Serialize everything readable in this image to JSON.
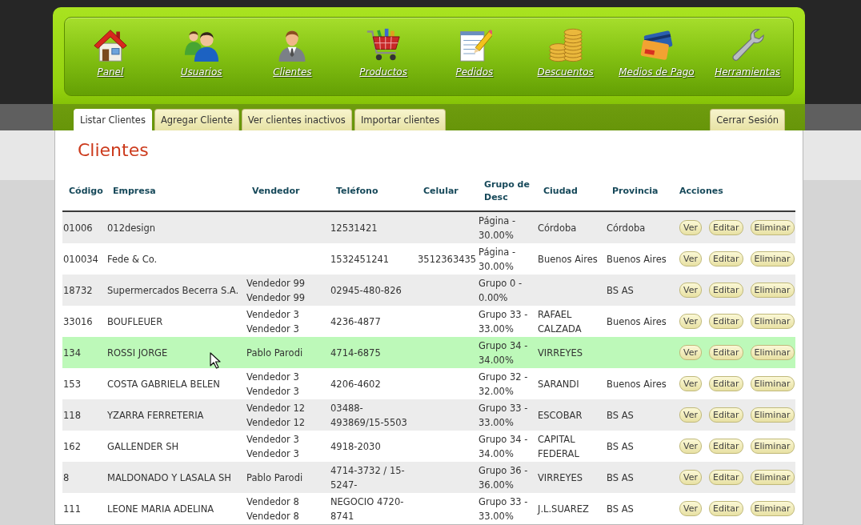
{
  "nav": {
    "items": [
      {
        "label": "Panel"
      },
      {
        "label": "Usuarios"
      },
      {
        "label": "Clientes"
      },
      {
        "label": "Productos"
      },
      {
        "label": "Pedidos"
      },
      {
        "label": "Descuentos"
      },
      {
        "label": "Medios de Pago"
      },
      {
        "label": "Herramientas"
      }
    ]
  },
  "tabs": [
    {
      "label": "Listar Clientes",
      "selected": true
    },
    {
      "label": "Agregar Cliente",
      "selected": false
    },
    {
      "label": "Ver clientes inactivos",
      "selected": false
    },
    {
      "label": "Importar clientes",
      "selected": false
    }
  ],
  "logout_button": {
    "label": "Cerrar Sesión"
  },
  "page_title": "Clientes",
  "table": {
    "columns": [
      "Código",
      "Empresa",
      "Vendedor",
      "Teléfono",
      "Celular",
      "Grupo de Desc",
      "Ciudad",
      "Provincia",
      "Acciones"
    ],
    "rows": [
      {
        "code": "01006",
        "company": "012design",
        "phone": "12531421",
        "discount_group": "Página - 30.00%",
        "city": "Córdoba",
        "province": "Córdoba",
        "actions": [
          "Ver",
          "Editar",
          "Eliminar"
        ],
        "selected": false
      },
      {
        "code": "010034",
        "company": "Fede & Co.",
        "phone": "1532451241",
        "mobile": "3512363435",
        "discount_group": "Página - 30.00%",
        "city": "Buenos Aires",
        "province": "Buenos Aires",
        "actions": [
          "Ver",
          "Editar",
          "Eliminar"
        ],
        "selected": false
      },
      {
        "code": "18732",
        "company": "Supermercados Becerra S.A.",
        "seller": "Vendedor 99 Vendedor 99",
        "phone": "02945-480-826",
        "discount_group": "Grupo 0 - 0.00%",
        "province": "BS AS",
        "actions": [
          "Ver",
          "Editar",
          "Eliminar"
        ],
        "selected": false
      },
      {
        "code": "33016",
        "company": "BOUFLEUER",
        "seller": "Vendedor 3 Vendedor 3",
        "phone": "4236-4877",
        "discount_group": "Grupo 33 - 33.00%",
        "city": "RAFAEL CALZADA",
        "province": "Buenos Aires",
        "actions": [
          "Ver",
          "Editar",
          "Eliminar"
        ],
        "selected": false
      },
      {
        "code": "134",
        "company": "ROSSI JORGE",
        "seller": "Pablo Parodi",
        "phone": "4714-6875",
        "discount_group": "Grupo 34 - 34.00%",
        "city": "VIRREYES",
        "actions": [
          "Ver",
          "Editar",
          "Eliminar"
        ],
        "selected": true
      },
      {
        "code": "153",
        "company": "COSTA GABRIELA BELEN",
        "seller": "Vendedor 3 Vendedor 3",
        "phone": "4206-4602",
        "discount_group": "Grupo 32 - 32.00%",
        "city": "SARANDI",
        "province": "Buenos Aires",
        "actions": [
          "Ver",
          "Editar",
          "Eliminar"
        ],
        "selected": false
      },
      {
        "code": "118",
        "company": "YZARRA FERRETERIA",
        "seller": "Vendedor 12 Vendedor 12",
        "phone": "03488-493869/15-5503",
        "discount_group": "Grupo 33 - 33.00%",
        "city": "ESCOBAR",
        "province": "BS AS",
        "actions": [
          "Ver",
          "Editar",
          "Eliminar"
        ],
        "selected": false
      },
      {
        "code": "162",
        "company": "GALLENDER SH",
        "seller": "Vendedor 3 Vendedor 3",
        "phone": "4918-2030",
        "discount_group": "Grupo 34 - 34.00%",
        "city": "CAPITAL FEDERAL",
        "province": "BS AS",
        "actions": [
          "Ver",
          "Editar",
          "Eliminar"
        ],
        "selected": false
      },
      {
        "code": "8",
        "company": "MALDONADO Y LASALA SH",
        "seller": "Pablo Parodi",
        "phone": "4714-3732 / 15-5247-",
        "discount_group": "Grupo 36 - 36.00%",
        "city": "VIRREYES",
        "province": "BS AS",
        "actions": [
          "Ver",
          "Editar",
          "Eliminar"
        ],
        "selected": false
      },
      {
        "code": "111",
        "company": "LEONE MARIA ADELINA",
        "seller": "Vendedor 8 Vendedor 8",
        "phone": "NEGOCIO 4720-8741",
        "discount_group": "Grupo 33 - 33.00%",
        "city": "J.L.SUAREZ",
        "province": "BS AS",
        "actions": [
          "Ver",
          "Editar",
          "Eliminar"
        ],
        "selected": false
      }
    ]
  }
}
